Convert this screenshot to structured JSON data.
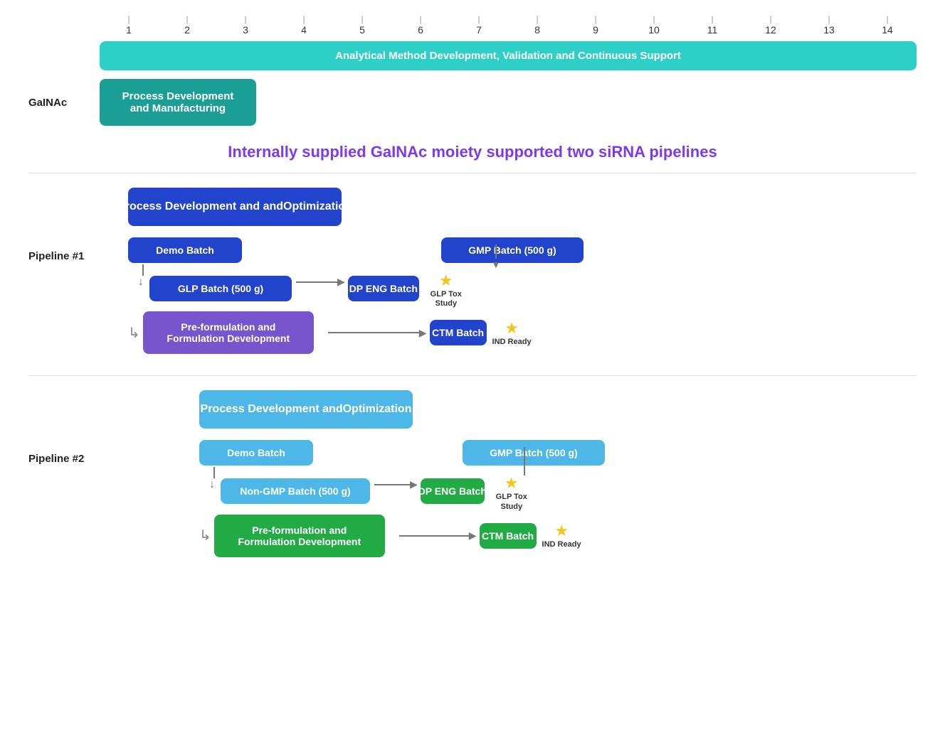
{
  "timeline": {
    "ticks": [
      "1",
      "2",
      "3",
      "4",
      "5",
      "6",
      "7",
      "8",
      "9",
      "10",
      "11",
      "12",
      "13",
      "14"
    ]
  },
  "analytical_bar": {
    "label": "Analytical Method Development, Validation and Continuous Support"
  },
  "gainac": {
    "label": "GaINAc",
    "box_line1": "Process Development",
    "box_line2": "and Manufacturing"
  },
  "subtitle": "Internally supplied GaINAc moiety supported two siRNA pipelines",
  "pipeline1": {
    "label": "Pipeline #1",
    "title_line1": "Process Development and",
    "title_line2": "Optimization",
    "demo_batch": "Demo Batch",
    "glp_batch": "GLP Batch (500 g)",
    "gmp_batch": "GMP Batch (500 g)",
    "preform": "Pre-formulation and\nFormulation Development",
    "dp_eng": "DP ENG\nBatch",
    "ctm_batch": "CTM\nBatch",
    "glp_tox": "GLP Tox\nStudy",
    "ind_ready": "IND Ready"
  },
  "pipeline2": {
    "label": "Pipeline #2",
    "title_line1": "Process Development and",
    "title_line2": "Optimization",
    "demo_batch": "Demo Batch",
    "non_gmp": "Non-GMP Batch (500 g)",
    "gmp_batch": "GMP Batch (500 g)",
    "preform": "Pre-formulation and\nFormulation Development",
    "dp_eng": "DP ENG\nBatch",
    "ctm_batch": "CTM\nBatch",
    "glp_tox": "GLP Tox\nStudy",
    "ind_ready": "IND\nReady"
  }
}
